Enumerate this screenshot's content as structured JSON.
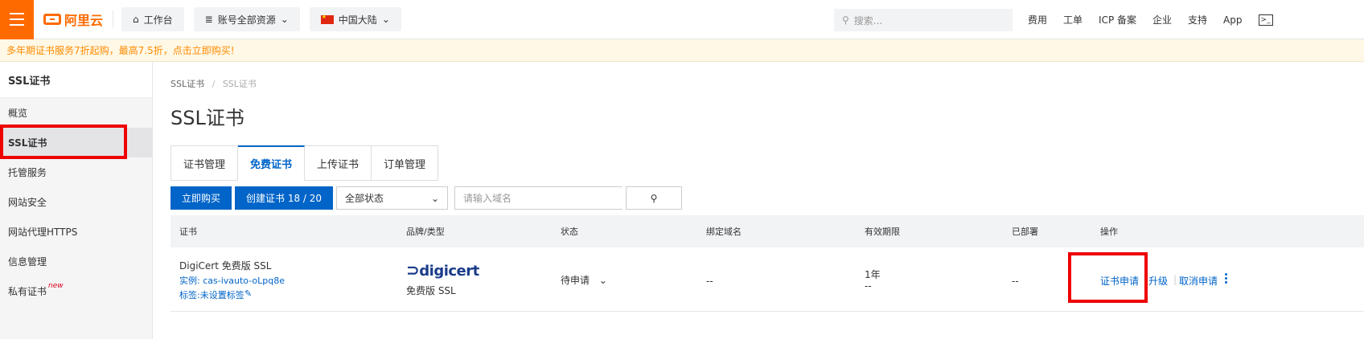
{
  "topbar": {
    "logo_text": "阿里云",
    "workbench": "工作台",
    "resources": "账号全部资源",
    "region": "中国大陆",
    "search_placeholder": "搜索...",
    "nav": [
      "费用",
      "工单",
      "ICP 备案",
      "企业",
      "支持",
      "App"
    ]
  },
  "banner": {
    "text": "多年期证书服务7折起购，最高7.5折，点击立即购买!"
  },
  "sidebar": {
    "title": "SSL证书",
    "items": [
      {
        "label": "概览"
      },
      {
        "label": "SSL证书"
      },
      {
        "label": "托管服务"
      },
      {
        "label": "网站安全"
      },
      {
        "label": "网站代理HTTPS"
      },
      {
        "label": "信息管理"
      },
      {
        "label": "私有证书",
        "badge": "new"
      }
    ]
  },
  "breadcrumb": {
    "root": "SSL证书",
    "sep": "/",
    "current": "SSL证书"
  },
  "page_title": "SSL证书",
  "tabs": [
    {
      "label": "证书管理"
    },
    {
      "label": "免费证书"
    },
    {
      "label": "上传证书"
    },
    {
      "label": "订单管理"
    }
  ],
  "toolbar": {
    "buy": "立即购买",
    "create": "创建证书 18 / 20",
    "status_filter": "全部状态",
    "domain_placeholder": "请输入域名"
  },
  "table": {
    "headers": [
      "证书",
      "品牌/类型",
      "状态",
      "绑定域名",
      "有效期限",
      "已部署",
      "操作"
    ],
    "rows": [
      {
        "name": "DigiCert 免费版 SSL",
        "instance": "实例: cas-ivauto-oLpq8e",
        "tag": "标签:未设置标签",
        "brand_logo": "digicert",
        "type": "免费版 SSL",
        "status": "待申请",
        "domain": "--",
        "validity": "1年",
        "validity_sub": "--",
        "deployed": "--",
        "actions": [
          "证书申请",
          "升级",
          "取消申请"
        ]
      }
    ]
  },
  "colors": {
    "brand": "#ff6a00",
    "primary": "#0064c8",
    "highlight": "#ee0000"
  }
}
